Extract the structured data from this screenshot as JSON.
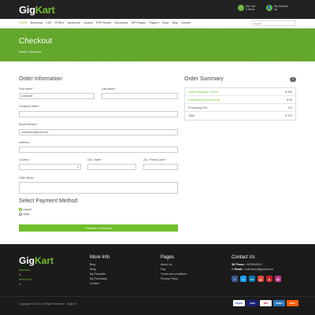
{
  "brand": {
    "name_part1": "Gig",
    "name_part2": "Kart"
  },
  "header": {
    "cart_label": "My Cart",
    "cart_value": "0 items",
    "account_label": "My Account",
    "account_value": "aa"
  },
  "nav": {
    "items": [
      "HOME",
      "Bootstrap",
      "CSS",
      "HTML5",
      "JavaScript",
      "Laravel",
      "PHP Scripts",
      "Wordpress",
      "WP Plugins",
      "Pages ▾",
      "Shop",
      "Blog",
      "Contact"
    ],
    "search_placeholder": "Search"
  },
  "banner": {
    "title": "Checkout",
    "breadcrumb": "Home  /  Checkout"
  },
  "order_info": {
    "title": "Order Information",
    "first_name_label": "First name",
    "first_name_value": "codeoner",
    "last_name_label": "Last name",
    "last_name_value": "",
    "company_label": "Company Name",
    "email_label": "Email Address",
    "email_value": "codeoner@gmail.com",
    "address_label": "Address",
    "country_label": "Country",
    "city_label": "City / State",
    "zip_label": "Zip / Postal Code",
    "notes_label": "Other Notes",
    "required_mark": "*"
  },
  "payment": {
    "title": "Select Payment Method",
    "options": [
      "paypal",
      "stripe"
    ],
    "selected": "paypal",
    "continue_label": "Continue to checkout"
  },
  "summary": {
    "title": "Order Summary",
    "count": "2",
    "rows": [
      {
        "name": "Hotel Wordpress Theme",
        "price": "$ 299"
      },
      {
        "name": "Free training Server script",
        "price": "$ 99"
      },
      {
        "name": "Processing Fee",
        "price": "$ 5"
      },
      {
        "name": "Total",
        "price": "$ 373"
      }
    ]
  },
  "footer": {
    "members_label": "Members",
    "members_value": "3",
    "items_sold_label": "Items Sold",
    "items_sold_value": "4",
    "more_info_title": "More Info",
    "more_info_links": [
      "Blog",
      "Shop",
      "My Favourite",
      "My Purchases",
      "Contact"
    ],
    "pages_title": "Pages",
    "pages_links": [
      "About Us",
      "Faq",
      "Terms and conditions",
      "Privacy Policy"
    ],
    "contact_title": "Contact Us",
    "phone_label": "Phone :",
    "phone_value": "9876543210",
    "email_label": "Email :",
    "email_value": "codecanon@gmail.com",
    "copyright": "Copyright © 2019, All Right Reserved , GigKart",
    "cards": [
      "PayPal",
      "VISA",
      "MC",
      "AMEX",
      "DISC"
    ]
  },
  "colors": {
    "accent": "#6fbe2a",
    "dark": "#222222",
    "footer": "#1b1b1b"
  }
}
